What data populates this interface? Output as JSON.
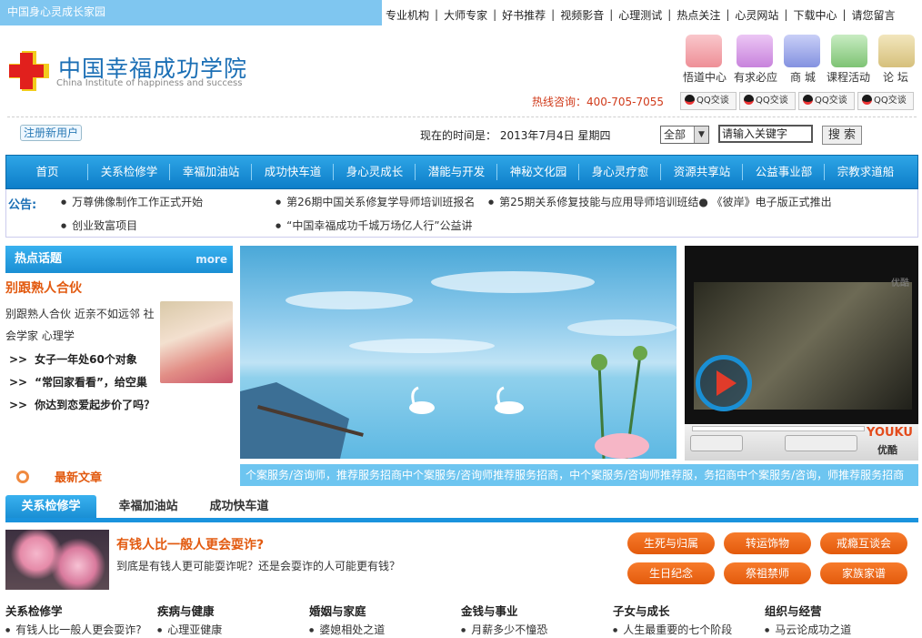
{
  "topbar": {
    "site_label": "中国身心灵成长家园",
    "links": [
      "专业机构",
      "大师专家",
      "好书推荐",
      "视频影音",
      "心理测试",
      "热点关注",
      "心灵网站",
      "下载中心",
      "请您留言"
    ]
  },
  "logo": {
    "cn": "中国幸福成功学院",
    "en": "China Institute of happiness and success"
  },
  "quick": [
    {
      "label": "悟道中心",
      "color": "#f4a0a6"
    },
    {
      "label": "有求必应",
      "color": "#d89ee8"
    },
    {
      "label": "商 城",
      "color": "#9aa6e8"
    },
    {
      "label": "课程活动",
      "color": "#8fd08a"
    },
    {
      "label": "论 坛",
      "color": "#e2cf90"
    }
  ],
  "hotline": "热线咨询：400-705-7055",
  "qq_label": "QQ交谈",
  "register": "注册新用户",
  "time_text": "现在的时间是： 2013年7月4日 星期四",
  "search": {
    "scope": "全部",
    "keyword": "请输入关键字",
    "button": "搜 索"
  },
  "nav": [
    "首页",
    "关系检修学",
    "幸福加油站",
    "成功快车道",
    "身心灵成长",
    "潜能与开发",
    "神秘文化园",
    "身心灵疗愈",
    "资源共享站",
    "公益事业部",
    "宗教求道船"
  ],
  "notice": {
    "label": "公告:",
    "items": [
      "万尊佛像制作工作正式开始",
      "第26期中国关系修复学导师培训班报名",
      "第25期关系修复技能与应用导师培训班结● 《彼岸》电子版正式推出",
      "创业致富项目",
      "“中国幸福成功千城万场亿人行”公益讲"
    ]
  },
  "hot": {
    "title": "热点话题",
    "more": "more",
    "headline": "别跟熟人合伙",
    "desc": "别跟熟人合伙 近亲不如远邻 社会学家 心理学",
    "links": [
      "女子一年处60个对象",
      "“常回家看看”，给空巢",
      "你达到恋爱起步价了吗？"
    ]
  },
  "video": {
    "watermark": "优酷",
    "brand": "YOUKU",
    "brand_cn": "优酷"
  },
  "newest": "最新文章",
  "ticker": "个案服务/咨询师，推荐服务招商中个案服务/咨询师推荐服务招商，中个案服务/咨询师推荐服，务招商中个案服务/咨询，师推荐服务招商",
  "tabs": [
    "关系检修学",
    "幸福加油站",
    "成功快车道"
  ],
  "article": {
    "title": "有钱人比一般人更会耍诈?",
    "desc": "到底是有钱人更可能耍诈呢？还是会耍诈的人可能更有钱？"
  },
  "pills": [
    "生死与归属",
    "转运饰物",
    "戒瘾互谈会",
    "生日纪念",
    "祭祖禁师",
    "家族家谱"
  ],
  "categories": [
    {
      "title": "关系检修学",
      "item": "有钱人比一般人更会耍诈?"
    },
    {
      "title": "疾病与健康",
      "item": "心理亚健康"
    },
    {
      "title": "婚姻与家庭",
      "item": "婆媳相处之道"
    },
    {
      "title": "金钱与事业",
      "item": "月薪多少不憧恐"
    },
    {
      "title": "子女与成长",
      "item": "人生最重要的七个阶段"
    },
    {
      "title": "组织与经营",
      "item": "马云论成功之道"
    }
  ]
}
